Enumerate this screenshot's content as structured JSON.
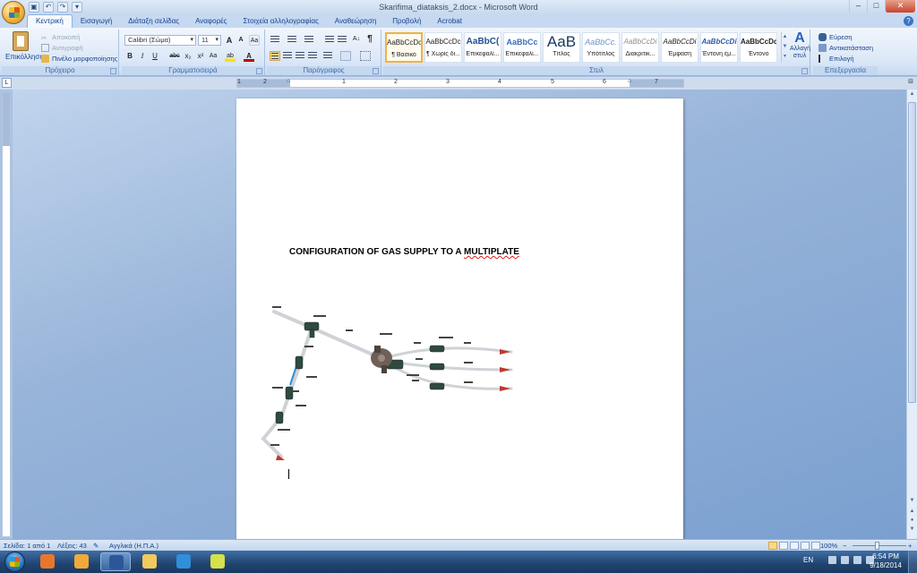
{
  "window": {
    "title": "Skarifima_diataksis_2.docx - Microsoft Word",
    "controls": [
      "–",
      "□",
      "✕"
    ]
  },
  "quick_access": {
    "save_glyph": "▣",
    "undo_glyph": "↶",
    "redo_glyph": "↷",
    "more_glyph": "▾"
  },
  "tabs": [
    "Κεντρική",
    "Εισαγωγή",
    "Διάταξη σελίδας",
    "Αναφορές",
    "Στοιχεία αλληλογραφίας",
    "Αναθεώρηση",
    "Προβολή",
    "Acrobat"
  ],
  "help_glyph": "?",
  "ribbon": {
    "clipboard": {
      "label": "Πρόχειρο",
      "paste": "Επικόλληση",
      "cut": "Αποκοπή",
      "copy": "Αντιγραφή",
      "format_painter": "Πινέλο μορφοποίησης"
    },
    "font": {
      "label": "Γραμματοσειρά",
      "font_name": "Calibri (Σώμα)",
      "font_size": "11",
      "grow": "A",
      "shrink": "A",
      "clear": "Aa",
      "bold": "B",
      "italic": "I",
      "underline": "U",
      "strike": "abc",
      "subscript": "x₂",
      "superscript": "x²",
      "change_case": "Aa",
      "highlight": "ab",
      "font_color": "A"
    },
    "paragraph": {
      "label": "Παράγραφος",
      "pilcrow": "¶",
      "sort": "A↓"
    },
    "styles": {
      "label": "Στυλ",
      "change_styles_glyph": "A",
      "change_styles": "Αλλαγή στυλ",
      "scroll": [
        "▲",
        "▼",
        "▾"
      ],
      "items": [
        {
          "sample": "AaBbCcDc",
          "name": "¶ Βασικό",
          "color": "#222222",
          "size": "8px",
          "style": "normal",
          "weight": "normal"
        },
        {
          "sample": "AaBbCcDc",
          "name": "¶ Χωρίς δι...",
          "color": "#222222",
          "size": "8px",
          "style": "normal",
          "weight": "normal"
        },
        {
          "sample": "AaBbC(",
          "name": "Επικεφαλί...",
          "color": "#1f4e92",
          "size": "10px",
          "style": "normal",
          "weight": "bold"
        },
        {
          "sample": "AaBbCc",
          "name": "Επικεφαλί...",
          "color": "#3b6fb8",
          "size": "9px",
          "style": "normal",
          "weight": "bold"
        },
        {
          "sample": "AaB",
          "name": "Τίτλος",
          "color": "#17365d",
          "size": "17px",
          "style": "normal",
          "weight": "normal"
        },
        {
          "sample": "AaBbCc.",
          "name": "Υπότιτλος",
          "color": "#6f93c8",
          "size": "9px",
          "style": "italic",
          "weight": "normal"
        },
        {
          "sample": "AaBbCcDi",
          "name": "Διακριτικ...",
          "color": "#8c8c8c",
          "size": "8px",
          "style": "italic",
          "weight": "normal"
        },
        {
          "sample": "AaBbCcDi",
          "name": "Έμφαση",
          "color": "#222222",
          "size": "8px",
          "style": "italic",
          "weight": "normal"
        },
        {
          "sample": "AaBbCcDi",
          "name": "Έντονη έμ...",
          "color": "#2a5aa8",
          "size": "8px",
          "style": "italic",
          "weight": "bold"
        },
        {
          "sample": "AaBbCcDc",
          "name": "Έντονο",
          "color": "#222222",
          "size": "8px",
          "style": "normal",
          "weight": "bold"
        }
      ]
    },
    "editing": {
      "label": "Επεξεργασία",
      "find": "Εύρεση",
      "replace": "Αντικατάσταση",
      "select": "Επιλογή"
    }
  },
  "ruler": {
    "corner": "L",
    "numbers": [
      "1",
      "2",
      "1",
      "2",
      "3",
      "4",
      "5",
      "6",
      "7"
    ],
    "toggle": "⊟"
  },
  "document": {
    "heading_part1": "CONFIGURATION OF GAS SUPPLY TO A ",
    "heading_part2": "MULTIPLATE"
  },
  "scrollbar": {
    "up": "▲",
    "down": "▼",
    "prev_page": "▲",
    "browse": "●",
    "next_page": "▼"
  },
  "status": {
    "page": "Σελίδα: 1 από 1",
    "words": "Λέξεις: 43",
    "language": "Αγγλικά (Η.Π.Α.)",
    "zoom": "100%",
    "zoom_minus": "−",
    "zoom_plus": "+"
  },
  "taskbar": {
    "language": "EN",
    "time": "6:54 PM",
    "date": "9/18/2014",
    "apps": [
      {
        "id": "firefox",
        "color": "#e8772e",
        "active": false
      },
      {
        "id": "app-orange",
        "color": "#f2a93b",
        "active": false
      },
      {
        "id": "word",
        "color": "#2b579a",
        "active": true
      },
      {
        "id": "explorer",
        "color": "#f2c95c",
        "active": false
      },
      {
        "id": "internet-explorer",
        "color": "#2f8fd8",
        "active": false
      },
      {
        "id": "pdf",
        "color": "#d6e04a",
        "active": false
      }
    ]
  },
  "colors": {
    "accent": "#15428b",
    "arrow": "#c0392b"
  }
}
